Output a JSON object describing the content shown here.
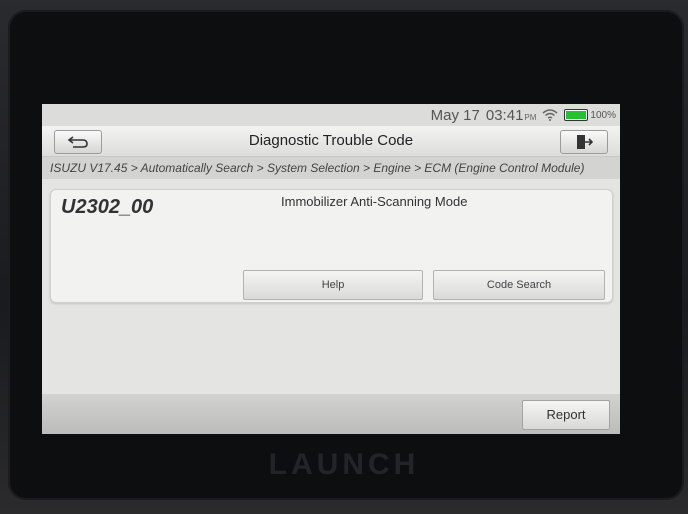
{
  "device": {
    "brand_text": "LAUNCH"
  },
  "status_bar": {
    "date": "May 17",
    "time": "03:41",
    "ampm": "PM",
    "battery_percent": 100,
    "battery_label": "100%",
    "wifi_icon": "wifi-icon",
    "battery_color": "#22c232"
  },
  "titlebar": {
    "title": "Diagnostic Trouble Code",
    "back_icon": "back-arrow-icon",
    "exit_icon": "exit-icon"
  },
  "breadcrumb": {
    "text": "ISUZU V17.45 > Automatically Search > System Selection > Engine > ECM (Engine Control Module)"
  },
  "dtc": {
    "code": "U2302_00",
    "description": "Immobilizer Anti-Scanning Mode",
    "help_label": "Help",
    "code_search_label": "Code Search"
  },
  "bottom_bar": {
    "report_label": "Report"
  }
}
